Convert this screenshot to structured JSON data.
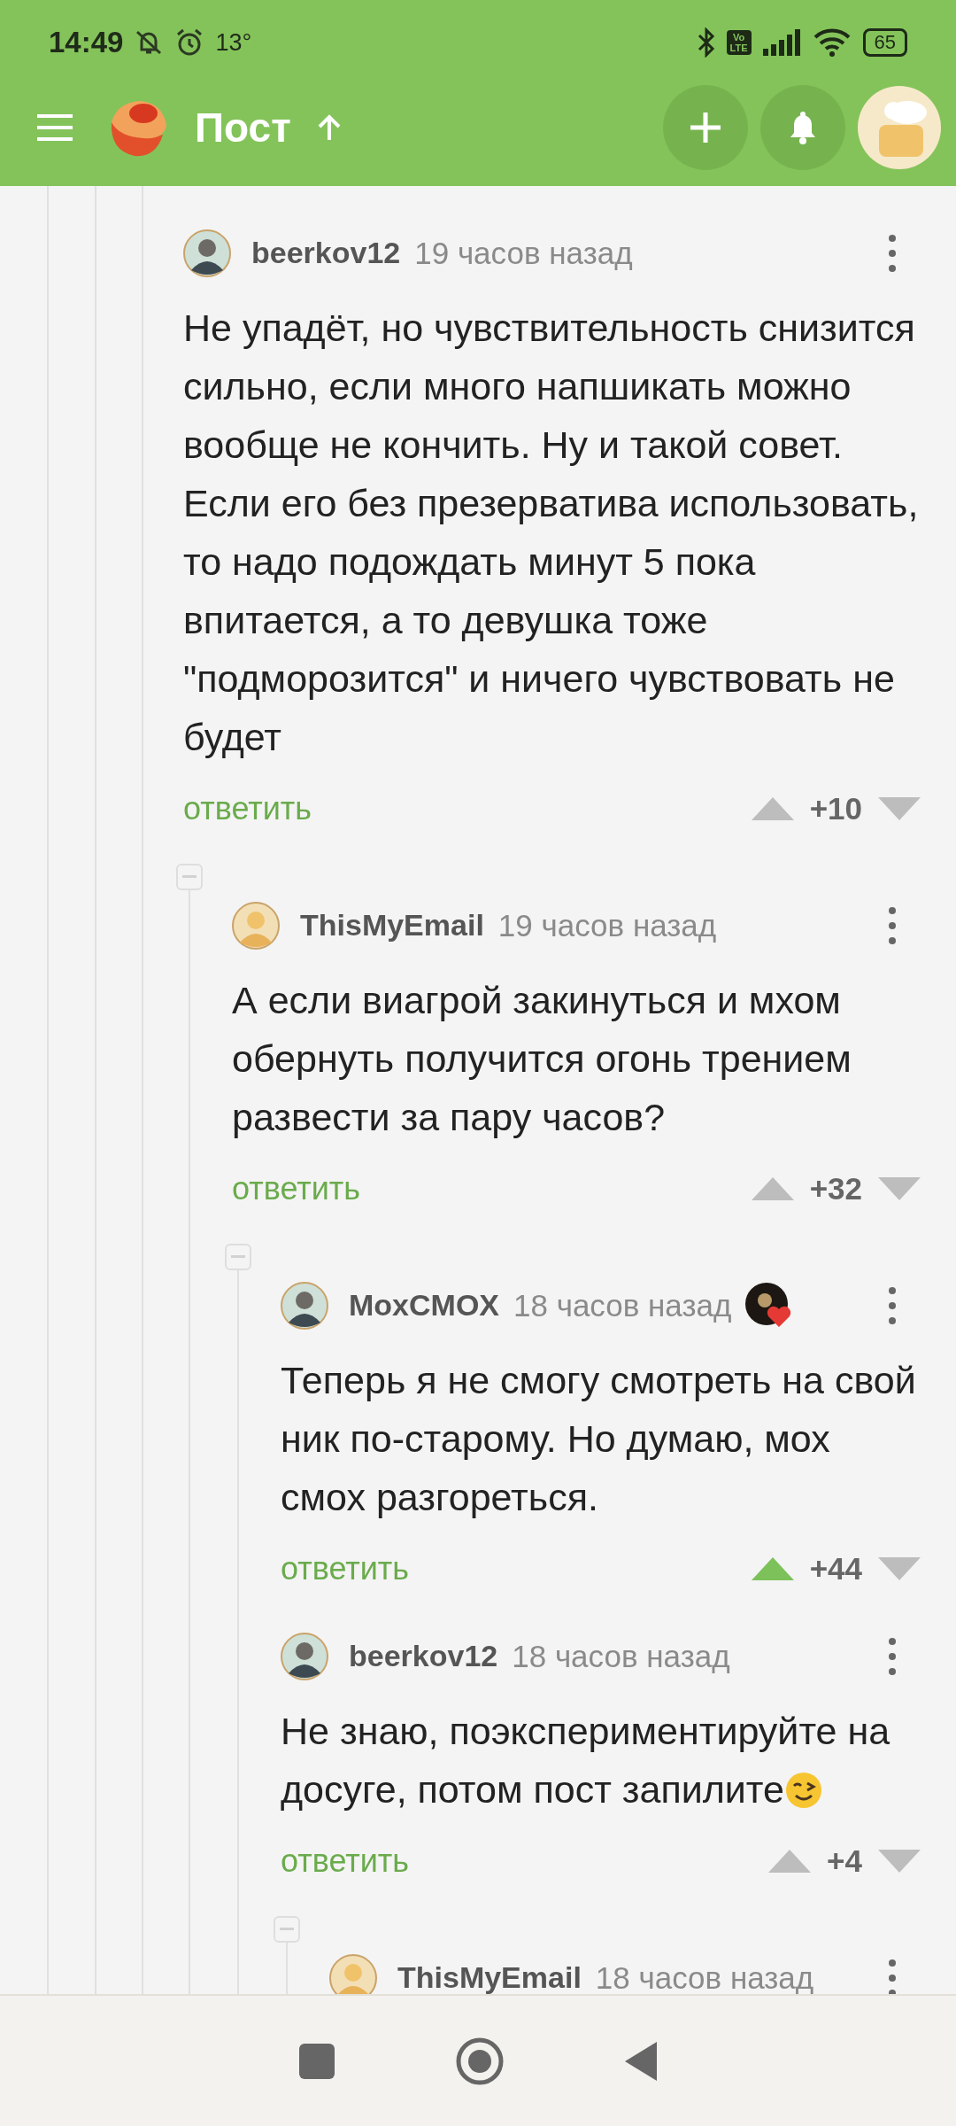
{
  "status_bar": {
    "time": "14:49",
    "temperature": "13°",
    "network": [
      "Vo",
      "LTE"
    ],
    "battery": "65"
  },
  "app_bar": {
    "title": "Пост"
  },
  "comments": [
    {
      "author": "beerkov12",
      "time": "19 часов назад",
      "text": "Не упадёт, но чувствительность снизится сильно, если много напшикать можно вообще не кончить. Ну и такой совет. Если его без презерватива использовать, то надо подождать минут 5 пока впитается, а то девушка тоже \"подморозится\" и ничего чувствовать не будет",
      "reply": "ответить",
      "score": "+10",
      "upvoted": false,
      "children": [
        {
          "author": "ThisMyEmail",
          "time": "19 часов назад",
          "text": "А если виагрой закинуться и мхом обернуть получится огонь трением развести за пару часов?",
          "reply": "ответить",
          "score": "+32",
          "upvoted": false,
          "children": [
            {
              "author": "MoxCMOX",
              "time": "18 часов назад",
              "award": true,
              "text": "Теперь я не смогу смотреть на свой ник по-старому. Но думаю, мох смох разгореться.",
              "reply": "ответить",
              "score": "+44",
              "upvoted": true
            },
            {
              "author": "beerkov12",
              "time": "18 часов назад",
              "text": "Не знаю, поэкспериментируйте на досуге, потом пост запилите",
              "emoji": true,
              "reply": "ответить",
              "score": "+4",
              "upvoted": false,
              "children": [
                {
                  "author": "ThisMyEmail",
                  "time": "18 часов назад"
                }
              ]
            }
          ]
        }
      ]
    }
  ]
}
